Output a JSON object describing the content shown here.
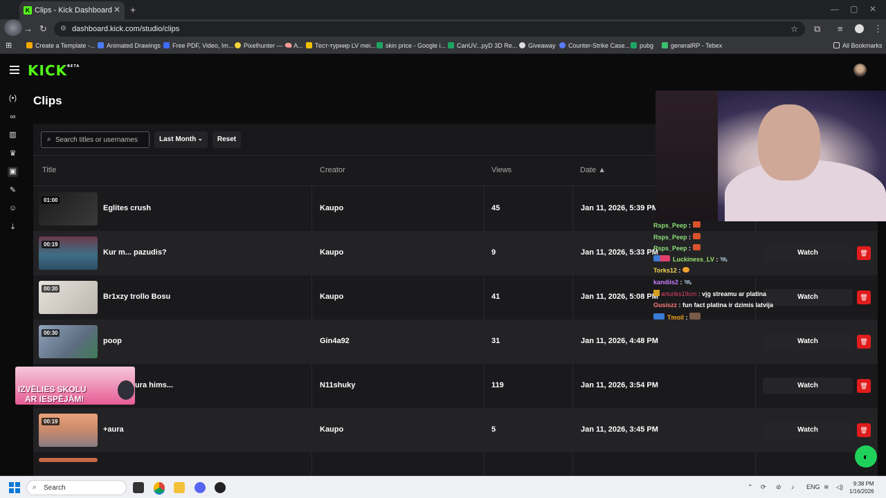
{
  "browser": {
    "tab_title": "Clips - Kick Dashboard",
    "tab_close": "✕",
    "new_tab": "+",
    "url": "dashboard.kick.com/studio/clips",
    "bookmarks": [
      {
        "label": "Create a Template -...",
        "color": "#f2a900"
      },
      {
        "label": "Animated Drawings",
        "color": "#4a7cf7"
      },
      {
        "label": "Free PDF, Video, Im...",
        "color": "#3d6cff"
      },
      {
        "label": "Pixelhunter — 🧠 A...",
        "color": "#f5d33a"
      },
      {
        "label": "Тест-турнир LV mei...",
        "color": "#f0c000"
      },
      {
        "label": "skin price - Google i...",
        "color": "#1fa463"
      },
      {
        "label": "CanUV...pyD 3D Re...",
        "color": "#1fa463"
      },
      {
        "label": "Giveaway",
        "color": "#dddddd"
      },
      {
        "label": "Counter-Strike Case...",
        "color": "#5a7cff"
      },
      {
        "label": "pubg",
        "color": "#1fa463"
      },
      {
        "label": "generalRP - Tebex",
        "color": "#3fbf6f"
      }
    ],
    "all_bookmarks": "All Bookmarks"
  },
  "app": {
    "logo": "KICK",
    "logo_badge": "BETA",
    "page_title": "Clips"
  },
  "filters": {
    "search_placeholder": "Search titles or usernames",
    "period": "Last Month",
    "reset": "Reset"
  },
  "table": {
    "headers": {
      "title": "Title",
      "creator": "Creator",
      "views": "Views",
      "date": "Date ▲"
    },
    "watch_label": "Watch",
    "rows": [
      {
        "duration": "01:00",
        "title": "Eglites crush",
        "creator": "Kaupo",
        "views": "45",
        "date": "Jan 11, 2026, 5:39 PM",
        "thumb": "#2b2b2b"
      },
      {
        "duration": "00:19",
        "title": "Kur m... pazudis?",
        "creator": "Kaupo",
        "views": "9",
        "date": "Jan 11, 2026, 5:33 PM",
        "thumb": "#3f6e86"
      },
      {
        "duration": "00:30",
        "title": "Br1xzy trollo Bosu",
        "creator": "Kaupo",
        "views": "41",
        "date": "Jan 11, 2026, 5:08 PM",
        "thumb": "#d9d4cc"
      },
      {
        "duration": "00:30",
        "title": "poop",
        "creator": "Gin4a92",
        "views": "31",
        "date": "Jan 11, 2026, 4:48 PM",
        "thumb": "#7b8ba1"
      },
      {
        "duration": "",
        "title": "ura hims...",
        "creator": "N11shuky",
        "views": "119",
        "date": "Jan 11, 2026, 3:54 PM",
        "thumb": "#5b4a3a"
      },
      {
        "duration": "00:19",
        "title": "+aura",
        "creator": "Kaupo",
        "views": "5",
        "date": "Jan 11, 2026, 3:45 PM",
        "thumb": "#d98a5c"
      }
    ]
  },
  "chat": [
    {
      "user": "Rsps_Peep",
      "text": "",
      "color": "#8ee07a"
    },
    {
      "user": "Rsps_Peep",
      "text": "",
      "color": "#8ee07a"
    },
    {
      "user": "Rsps_Peep",
      "text": "",
      "color": "#8ee07a"
    },
    {
      "user": "Luckiness_LV",
      "text": "",
      "color": "#9be36a"
    },
    {
      "user": "Torks12",
      "text": "",
      "color": "#f2d94e"
    },
    {
      "user": "kandiis2",
      "text": "",
      "color": "#c77dff"
    },
    {
      "user": "arturiks19cm",
      "text": "vjg streamu ar platina",
      "color": "#e0406a"
    },
    {
      "user": "Gusiszz",
      "text": "fun fact platina ir dzimis latvija",
      "color": "#ff7a7a"
    },
    {
      "user": "Tmoil",
      "text": "",
      "color": "#f5a623"
    }
  ],
  "ad": {
    "line1": "IZVĒLIES SKOLU",
    "line2": "AR IESPĒJĀM!"
  },
  "taskbar": {
    "search_label": "Search",
    "lang": "ENG",
    "time": "9:38 PM",
    "date": "1/16/2026"
  },
  "colors": {
    "accent": "#53fc18",
    "delete": "#e01c1c"
  }
}
